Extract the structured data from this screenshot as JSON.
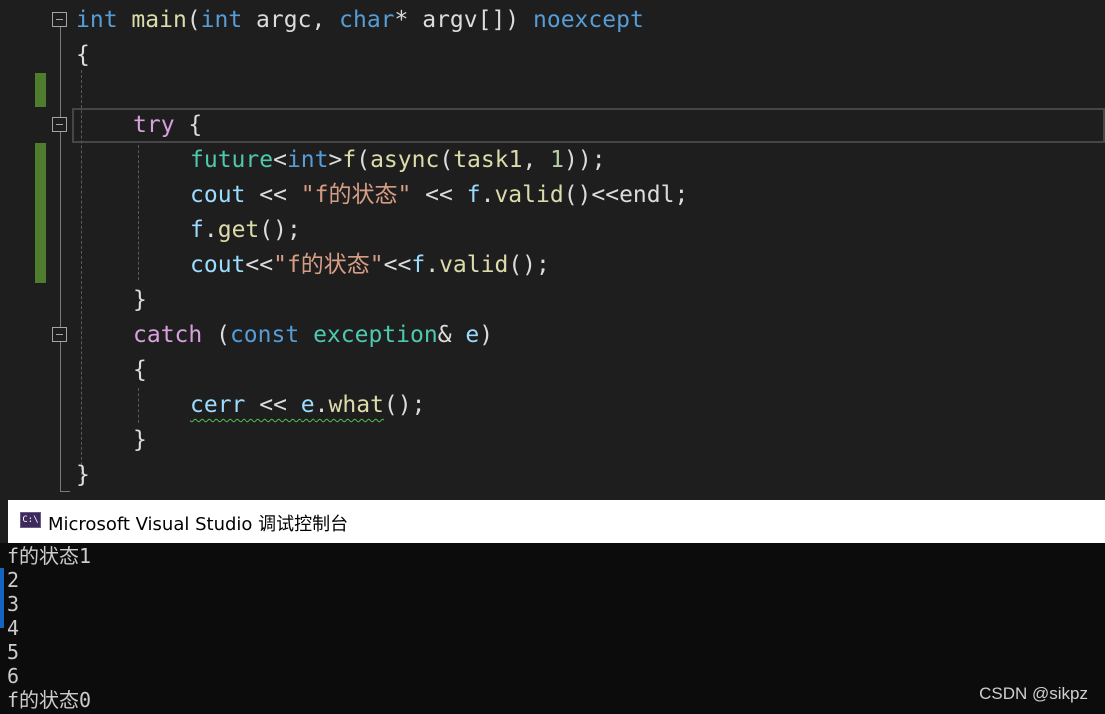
{
  "code": {
    "line1": {
      "t1": "int",
      "t2": " ",
      "t3": "main",
      "t4": "(",
      "t5": "int",
      "t6": " argc, ",
      "t7": "char",
      "t8": "* argv[]) ",
      "t9": "noexcept"
    },
    "line2": {
      "t1": "{"
    },
    "line3": {
      "t1": "try",
      "t2": " {"
    },
    "line4": {
      "t1": "future",
      "t2": "<",
      "t3": "int",
      "t4": ">",
      "t5": "f",
      "t6": "(",
      "t7": "async",
      "t8": "(",
      "t9": "task1",
      "t10": ", ",
      "t11": "1",
      "t12": "));"
    },
    "line5": {
      "t1": "cout",
      "t2": " << ",
      "t3": "\"f的状态\"",
      "t4": " << ",
      "t5": "f",
      "t6": ".",
      "t7": "valid",
      "t8": "()<<",
      "t9": "endl",
      "t10": ";"
    },
    "line6": {
      "t1": "f",
      "t2": ".",
      "t3": "get",
      "t4": "();"
    },
    "line7": {
      "t1": "cout",
      "t2": "<<",
      "t3": "\"f的状态\"",
      "t4": "<<",
      "t5": "f",
      "t6": ".",
      "t7": "valid",
      "t8": "();"
    },
    "line8": {
      "t1": "}"
    },
    "line9": {
      "t1": "catch",
      "t2": " (",
      "t3": "const",
      "t4": " ",
      "t5": "exception",
      "t6": "& ",
      "t7": "e",
      "t8": ")"
    },
    "line10": {
      "t1": "{"
    },
    "line11": {
      "t1": "cerr",
      "t2": " << ",
      "t3": "e",
      "t4": ".",
      "t5": "what",
      "t6": "();"
    },
    "line12": {
      "t1": "}"
    },
    "line13": {
      "t1": "}"
    }
  },
  "console": {
    "title": "Microsoft Visual Studio 调试控制台",
    "icon_text": "C:\\",
    "output": [
      "f的状态1",
      "2",
      "3",
      "4",
      "5",
      "6",
      "f的状态0"
    ]
  },
  "watermark": "CSDN @sikpz",
  "colors": {
    "keyword": "#569cd6",
    "control": "#d8a0df",
    "function": "#dcdcaa",
    "type": "#4ec9b0",
    "string": "#d69d85",
    "number": "#b5cea8",
    "variable": "#9cdcfe",
    "change_bar": "#4e7d2e"
  }
}
